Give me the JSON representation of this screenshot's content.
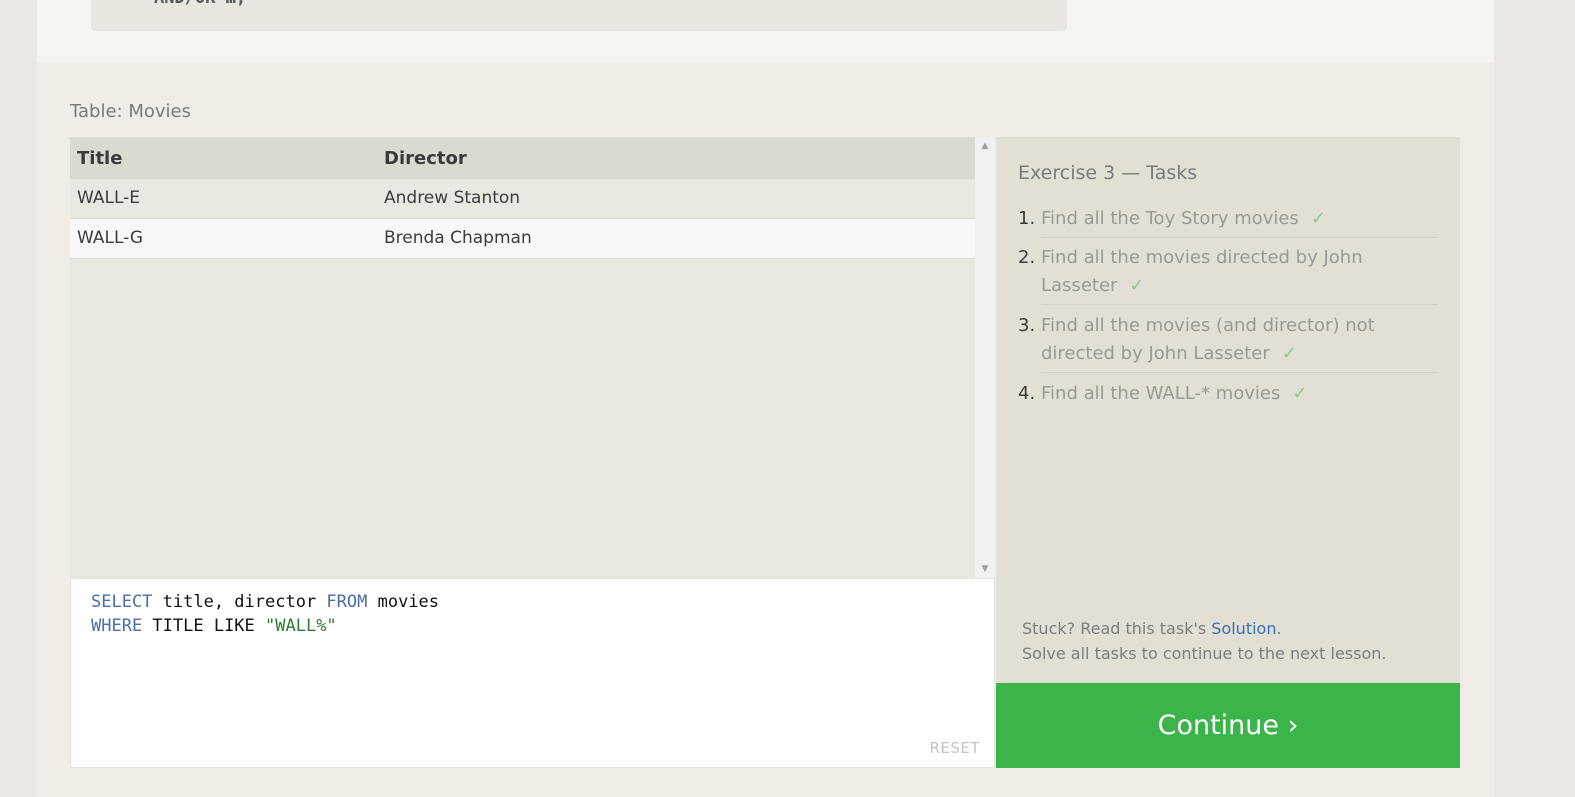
{
  "example_code": {
    "text": "AND/OR …;"
  },
  "table": {
    "label": "Table: Movies",
    "columns": [
      "Title",
      "Director"
    ],
    "rows": [
      [
        "WALL-E",
        "Andrew Stanton"
      ],
      [
        "WALL-G",
        "Brenda Chapman"
      ]
    ]
  },
  "scrollbar": {
    "up_glyph": "▲",
    "down_glyph": "▼"
  },
  "editor": {
    "line1": {
      "kw1": "SELECT",
      "mid1": " title, director ",
      "kw2": "FROM",
      "rest": " movies"
    },
    "line2": {
      "kw1": "WHERE",
      "mid": " TITLE LIKE ",
      "str": "\"WALL%\""
    },
    "reset_label": "RESET"
  },
  "tasks": {
    "title": "Exercise 3 — Tasks",
    "check_glyph": "✓",
    "items": [
      {
        "num": "1.",
        "text": "Find all the Toy Story movies"
      },
      {
        "num": "2.",
        "text": "Find all the movies directed by John Lasseter"
      },
      {
        "num": "3.",
        "text": "Find all the movies (and director) not directed by John Lasseter"
      },
      {
        "num": "4.",
        "text": "Find all the WALL-* movies"
      }
    ],
    "stuck_prefix": "Stuck? Read this task's ",
    "solution_link": "Solution",
    "stuck_suffix": ".",
    "solve_all": "Solve all tasks to continue to the next lesson."
  },
  "continue_label": "Continue ›",
  "colors": {
    "continue_bg": "#3bb44a",
    "check": "#8cc98e",
    "sql_keyword": "#4a6ea8",
    "sql_string": "#2e7d32",
    "link": "#3b6fb5"
  }
}
